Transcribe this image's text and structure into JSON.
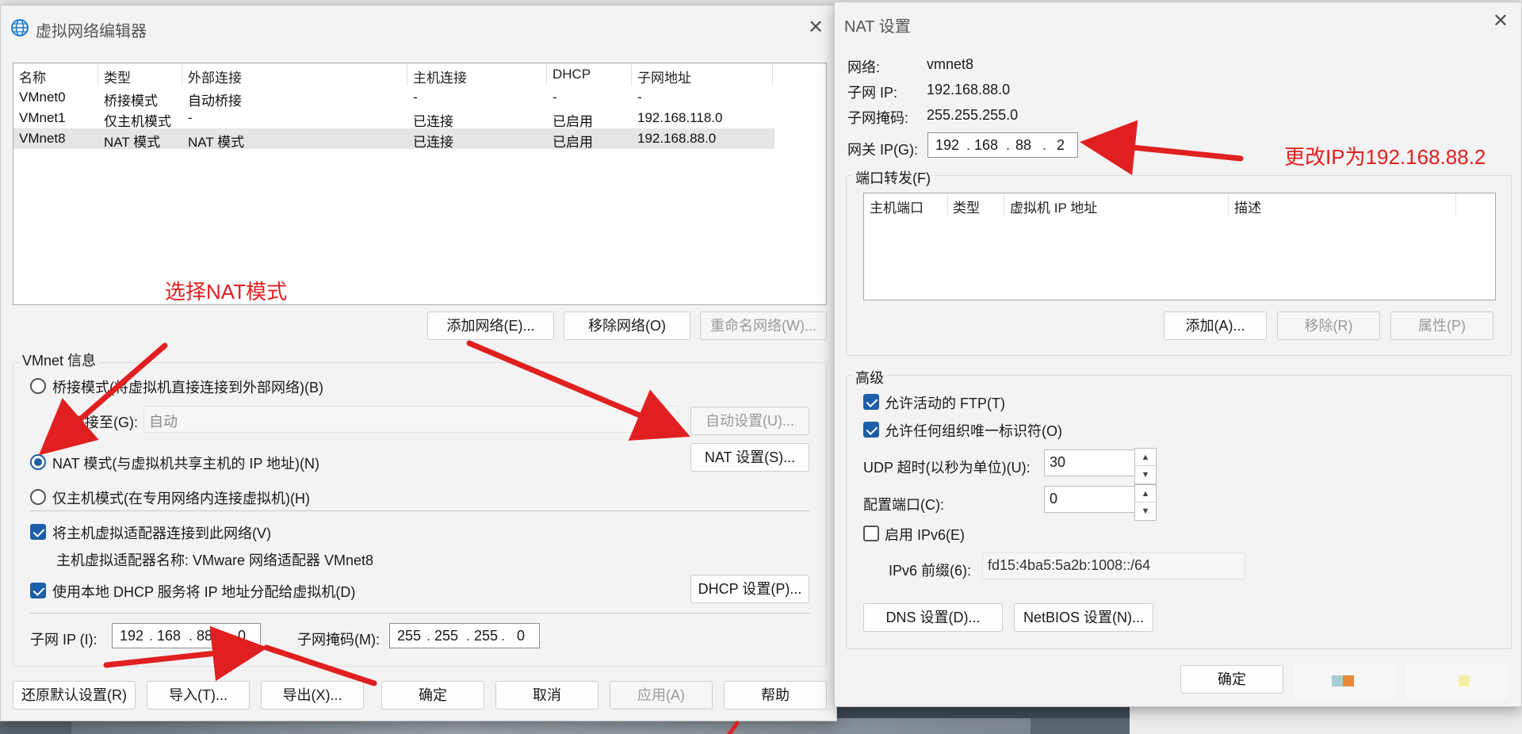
{
  "left_dialog": {
    "title": "虚拟网络编辑器",
    "close": "✕",
    "columns": [
      "名称",
      "类型",
      "外部连接",
      "主机连接",
      "DHCP",
      "子网地址"
    ],
    "rows": [
      [
        "VMnet0",
        "桥接模式",
        "自动桥接",
        "-",
        "-",
        "-"
      ],
      [
        "VMnet1",
        "仅主机模式",
        "-",
        "已连接",
        "已启用",
        "192.168.118.0"
      ],
      [
        "VMnet8",
        "NAT 模式",
        "NAT 模式",
        "已连接",
        "已启用",
        "192.168.88.0"
      ]
    ],
    "add_network": "添加网络(E)...",
    "remove_network": "移除网络(O)",
    "rename_network": "重命名网络(W)...",
    "vmnet_info": "VMnet 信息",
    "bridge_mode": "桥接模式(将虚拟机直接连接到外部网络)(B)",
    "bridged_to_label": "已桥接至(G):",
    "bridged_to_value": "自动",
    "auto_settings": "自动设置(U)...",
    "nat_mode": "NAT 模式(与虚拟机共享主机的 IP 地址)(N)",
    "nat_settings": "NAT 设置(S)...",
    "host_only_mode": "仅主机模式(在专用网络内连接虚拟机)(H)",
    "connect_adapter": "将主机虚拟适配器连接到此网络(V)",
    "adapter_name": "主机虚拟适配器名称: VMware 网络适配器 VMnet8",
    "use_dhcp": "使用本地 DHCP 服务将 IP 地址分配给虚拟机(D)",
    "dhcp_settings": "DHCP 设置(P)...",
    "subnet_ip_label": "子网 IP (I):",
    "subnet_ip": [
      "192",
      "168",
      "88",
      "0"
    ],
    "subnet_mask_label": "子网掩码(M):",
    "subnet_mask": [
      "255",
      "255",
      "255",
      "0"
    ],
    "restore_defaults": "还原默认设置(R)",
    "import": "导入(T)...",
    "export": "导出(X)...",
    "ok": "确定",
    "cancel": "取消",
    "apply": "应用(A)",
    "help": "帮助"
  },
  "right_dialog": {
    "title": "NAT 设置",
    "close": "✕",
    "network_label": "网络:",
    "network_value": "vmnet8",
    "subnet_ip_label": "子网 IP:",
    "subnet_ip_value": "192.168.88.0",
    "subnet_mask_label": "子网掩码:",
    "subnet_mask_value": "255.255.255.0",
    "gateway_label": "网关 IP(G):",
    "gateway_ip": [
      "192",
      "168",
      "88",
      "2"
    ],
    "port_forwarding": "端口转发(F)",
    "pf_columns": [
      "主机端口",
      "类型",
      "虚拟机 IP 地址",
      "描述"
    ],
    "add": "添加(A)...",
    "remove": "移除(R)",
    "properties": "属性(P)",
    "advanced": "高级",
    "allow_ftp": "允许活动的 FTP(T)",
    "allow_uid": "允许任何组织唯一标识符(O)",
    "udp_timeout_label": "UDP 超时(以秒为单位)(U):",
    "udp_timeout_value": "30",
    "config_port_label": "配置端口(C):",
    "config_port_value": "0",
    "enable_ipv6": "启用 IPv6(E)",
    "ipv6_prefix_label": "IPv6 前缀(6):",
    "ipv6_prefix_value": "fd15:4ba5:5a2b:1008::/64",
    "dns_settings": "DNS 设置(D)...",
    "netbios_settings": "NetBIOS 设置(N)...",
    "ok": "确定"
  },
  "annotations": {
    "select_nat": "选择NAT模式",
    "change_ip": "更改IP为192.168.88.2"
  },
  "colors": {
    "annotation_red": "#e02020",
    "accent_blue": "#1d5ea8"
  }
}
